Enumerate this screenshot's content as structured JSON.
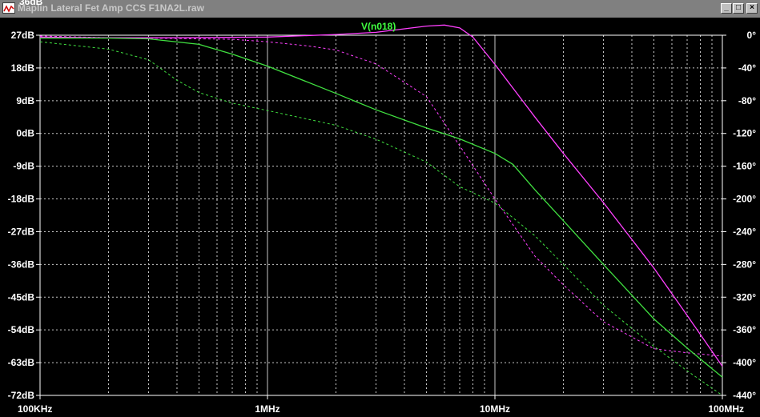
{
  "window": {
    "title": "Maplin Lateral Fet Amp CCS F1NA2L.raw",
    "minimize_label": "_",
    "maximize_label": "□",
    "close_label": "×"
  },
  "colors": {
    "background": "#000000",
    "grid": "#c8c8c8",
    "axis_text": "#ffffff",
    "magenta_trace": "#ff40ff",
    "green_trace": "#40e040",
    "trace_label": "#40ff40"
  },
  "chart_data": {
    "type": "line",
    "x_scale": "log",
    "x_unit": "Hz",
    "xlim": [
      100000,
      100000000
    ],
    "x_tick_labels": [
      "100KHz",
      "1MHz",
      "10MHz",
      "100MHz"
    ],
    "ylim_left": [
      -72,
      27
    ],
    "y_ticks_left": [
      27,
      18,
      9,
      0,
      -9,
      -18,
      -27,
      -36,
      -45,
      -54,
      -63,
      -72
    ],
    "y_tick_labels_left": [
      "27dB",
      "18dB",
      "9dB",
      "0dB",
      "-9dB",
      "-18dB",
      "-27dB",
      "-36dB",
      "-45dB",
      "-54dB",
      "-63dB",
      "-72dB"
    ],
    "top_clipped_label": "36dB",
    "ylim_right": [
      -440,
      0
    ],
    "y_ticks_right": [
      0,
      -40,
      -80,
      -120,
      -160,
      -200,
      -240,
      -280,
      -320,
      -360,
      -400,
      -440
    ],
    "y_tick_labels_right": [
      "0°",
      "-40°",
      "-80°",
      "-120°",
      "-160°",
      "-200°",
      "-240°",
      "-280°",
      "-320°",
      "-360°",
      "-400°",
      "-440°"
    ],
    "grid": true,
    "trace_label": "V(n018)",
    "series": [
      {
        "name": "V(n018)",
        "axis": "left",
        "style": "solid",
        "color": "#ff40ff",
        "x": [
          100000,
          200000,
          400000,
          1000000,
          2000000,
          3000000,
          5000000,
          6000000,
          7000000,
          8000000,
          10000000,
          15000000,
          20000000,
          30000000,
          50000000,
          70000000,
          100000000
        ],
        "y": [
          26.5,
          26.3,
          26.3,
          26.5,
          27.2,
          27.8,
          29.5,
          29.8,
          29,
          26.5,
          19,
          4.5,
          -5.5,
          -19,
          -37,
          -50,
          -64
        ]
      },
      {
        "axis": "right",
        "style": "dashed",
        "color": "#ff40ff",
        "x": [
          100000,
          200000,
          400000,
          700000,
          1000000,
          1500000,
          2000000,
          3000000,
          5000000,
          7000000,
          10000000,
          15000000,
          20000000,
          30000000,
          50000000,
          70000000,
          100000000
        ],
        "y": [
          -1,
          -3,
          -4,
          -5,
          -8,
          -13,
          -18,
          -35,
          -75,
          -135,
          -200,
          -270,
          -305,
          -350,
          -383,
          -388,
          -392
        ]
      },
      {
        "axis": "left",
        "style": "solid",
        "color": "#40e040",
        "x": [
          100000,
          200000,
          300000,
          500000,
          700000,
          1000000,
          2000000,
          3000000,
          5000000,
          7000000,
          10000000,
          12000000,
          15000000,
          20000000,
          30000000,
          50000000,
          70000000,
          100000000
        ],
        "y": [
          26.2,
          26.2,
          26,
          24.5,
          21.8,
          18.5,
          11,
          6.5,
          1.5,
          -1.5,
          -5.5,
          -8.5,
          -15.5,
          -24,
          -36,
          -51,
          -59,
          -67
        ]
      },
      {
        "axis": "right",
        "style": "dashed",
        "color": "#40e040",
        "x": [
          100000,
          200000,
          300000,
          400000,
          500000,
          700000,
          1000000,
          2000000,
          3000000,
          5000000,
          7000000,
          10000000,
          15000000,
          20000000,
          30000000,
          50000000,
          70000000,
          100000000
        ],
        "y": [
          -8,
          -17,
          -30,
          -55,
          -70,
          -83,
          -92,
          -110,
          -127,
          -155,
          -185,
          -205,
          -245,
          -280,
          -330,
          -380,
          -410,
          -440
        ]
      }
    ]
  }
}
